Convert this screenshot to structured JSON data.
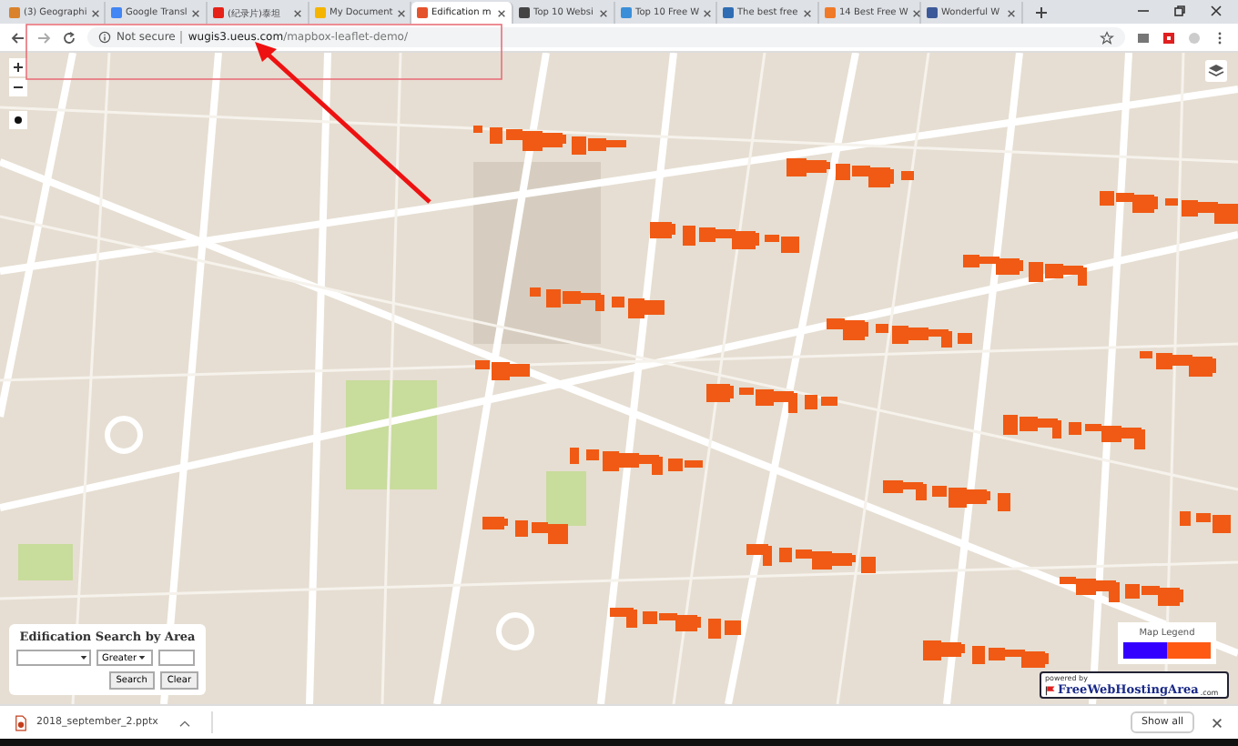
{
  "browser": {
    "tabs": [
      {
        "title": "(3) Geographi",
        "color": "#d9822b",
        "selected": false
      },
      {
        "title": "Google Transl",
        "color": "#4285f4",
        "selected": false
      },
      {
        "title": "(纪录片)泰坦",
        "color": "#e62117",
        "selected": false
      },
      {
        "title": "My Document",
        "color": "#f4b400",
        "selected": false
      },
      {
        "title": "Edification m",
        "color": "#e5532d",
        "selected": true
      },
      {
        "title": "Top 10 Websi",
        "color": "#444444",
        "selected": false
      },
      {
        "title": "Top 10 Free W",
        "color": "#3b8fd9",
        "selected": false
      },
      {
        "title": "The best free",
        "color": "#2e6db4",
        "selected": false
      },
      {
        "title": "14 Best Free W",
        "color": "#f07a28",
        "selected": false
      },
      {
        "title": "Wonderful W",
        "color": "#3b5998",
        "selected": false
      }
    ],
    "security": "Not secure",
    "url_host": "wugis3.ueus.com",
    "url_path": "/mapbox-leaflet-demo/"
  },
  "search_panel": {
    "title": "Edification Search by Area",
    "operator": "Greater",
    "buttons": [
      "Search",
      "Clear"
    ]
  },
  "legend": {
    "title": "Map Legend",
    "swatches": [
      {
        "color": "#3300ff"
      },
      {
        "color": "#ff5a14"
      }
    ]
  },
  "badge": {
    "prefix": "powered by",
    "name": "FreeWebHostingArea",
    "suffix": ".com"
  },
  "download_bar": {
    "file": "2018_september_2.pptx",
    "button": "Show all"
  }
}
